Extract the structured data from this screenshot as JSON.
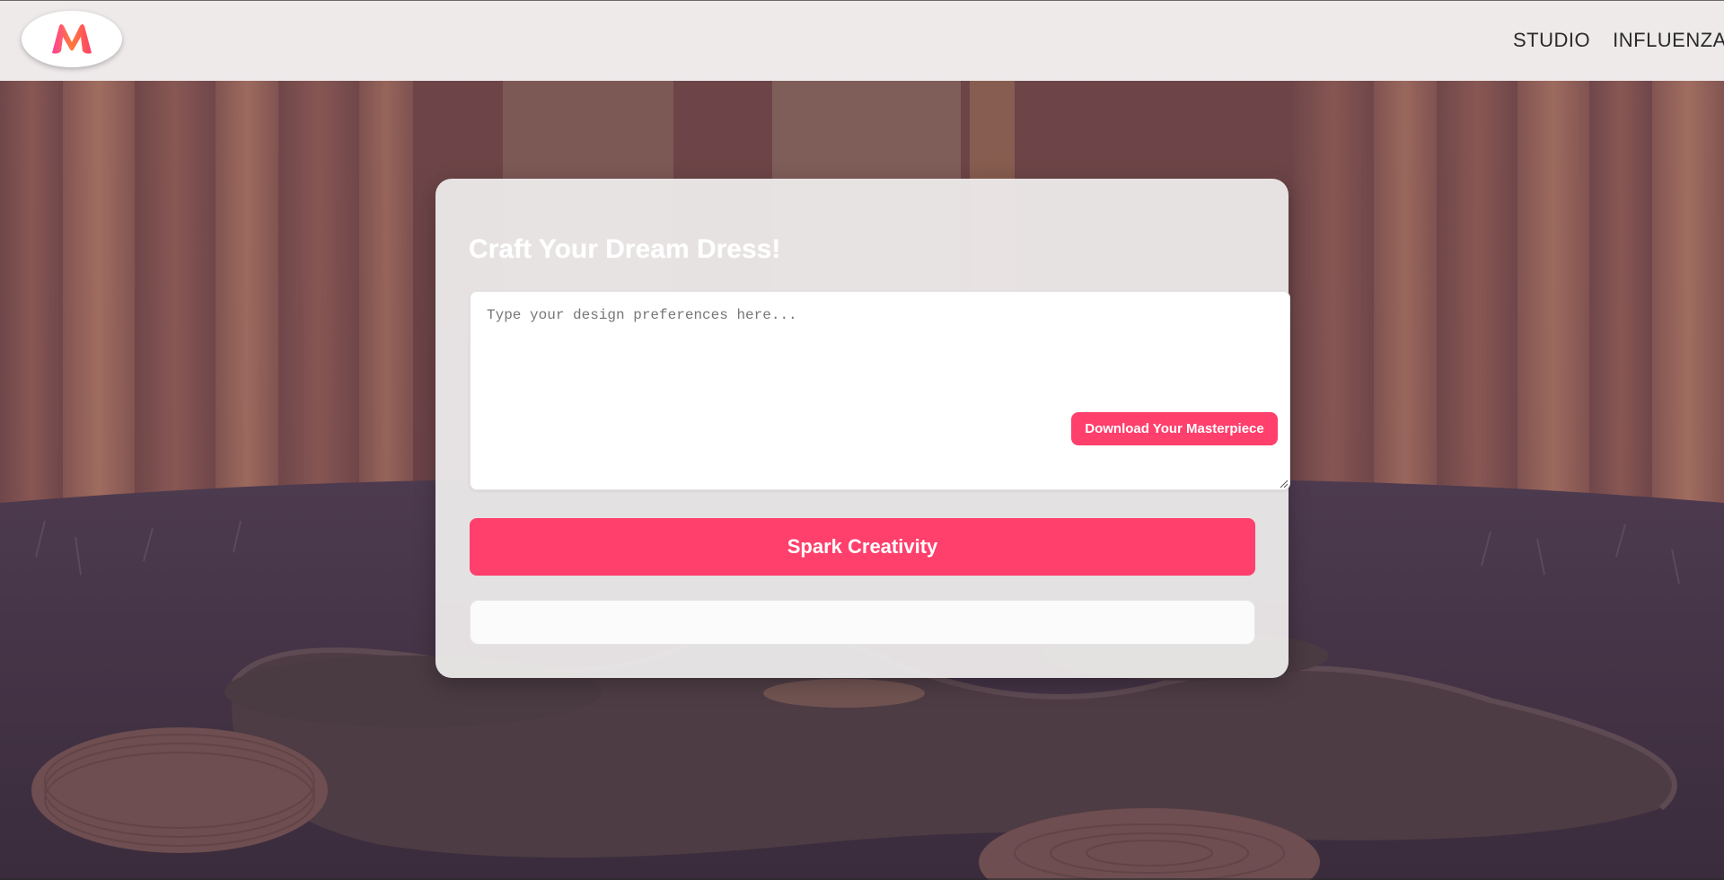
{
  "brand": {
    "logo_icon": "myntra-m-logo",
    "accent_color": "#ff3f6c"
  },
  "nav": {
    "items": [
      {
        "label": "STUDIO"
      },
      {
        "label": "INFLUENZA"
      }
    ]
  },
  "card": {
    "title": "Craft Your Dream Dress!",
    "prompt_placeholder": "Type your design preferences here...",
    "prompt_value": "",
    "download_label": "Download Your Masterpiece",
    "spark_label": "Spark Creativity",
    "output_text": ""
  },
  "background": {
    "scene": "dreamy-forest-room-illustration"
  }
}
